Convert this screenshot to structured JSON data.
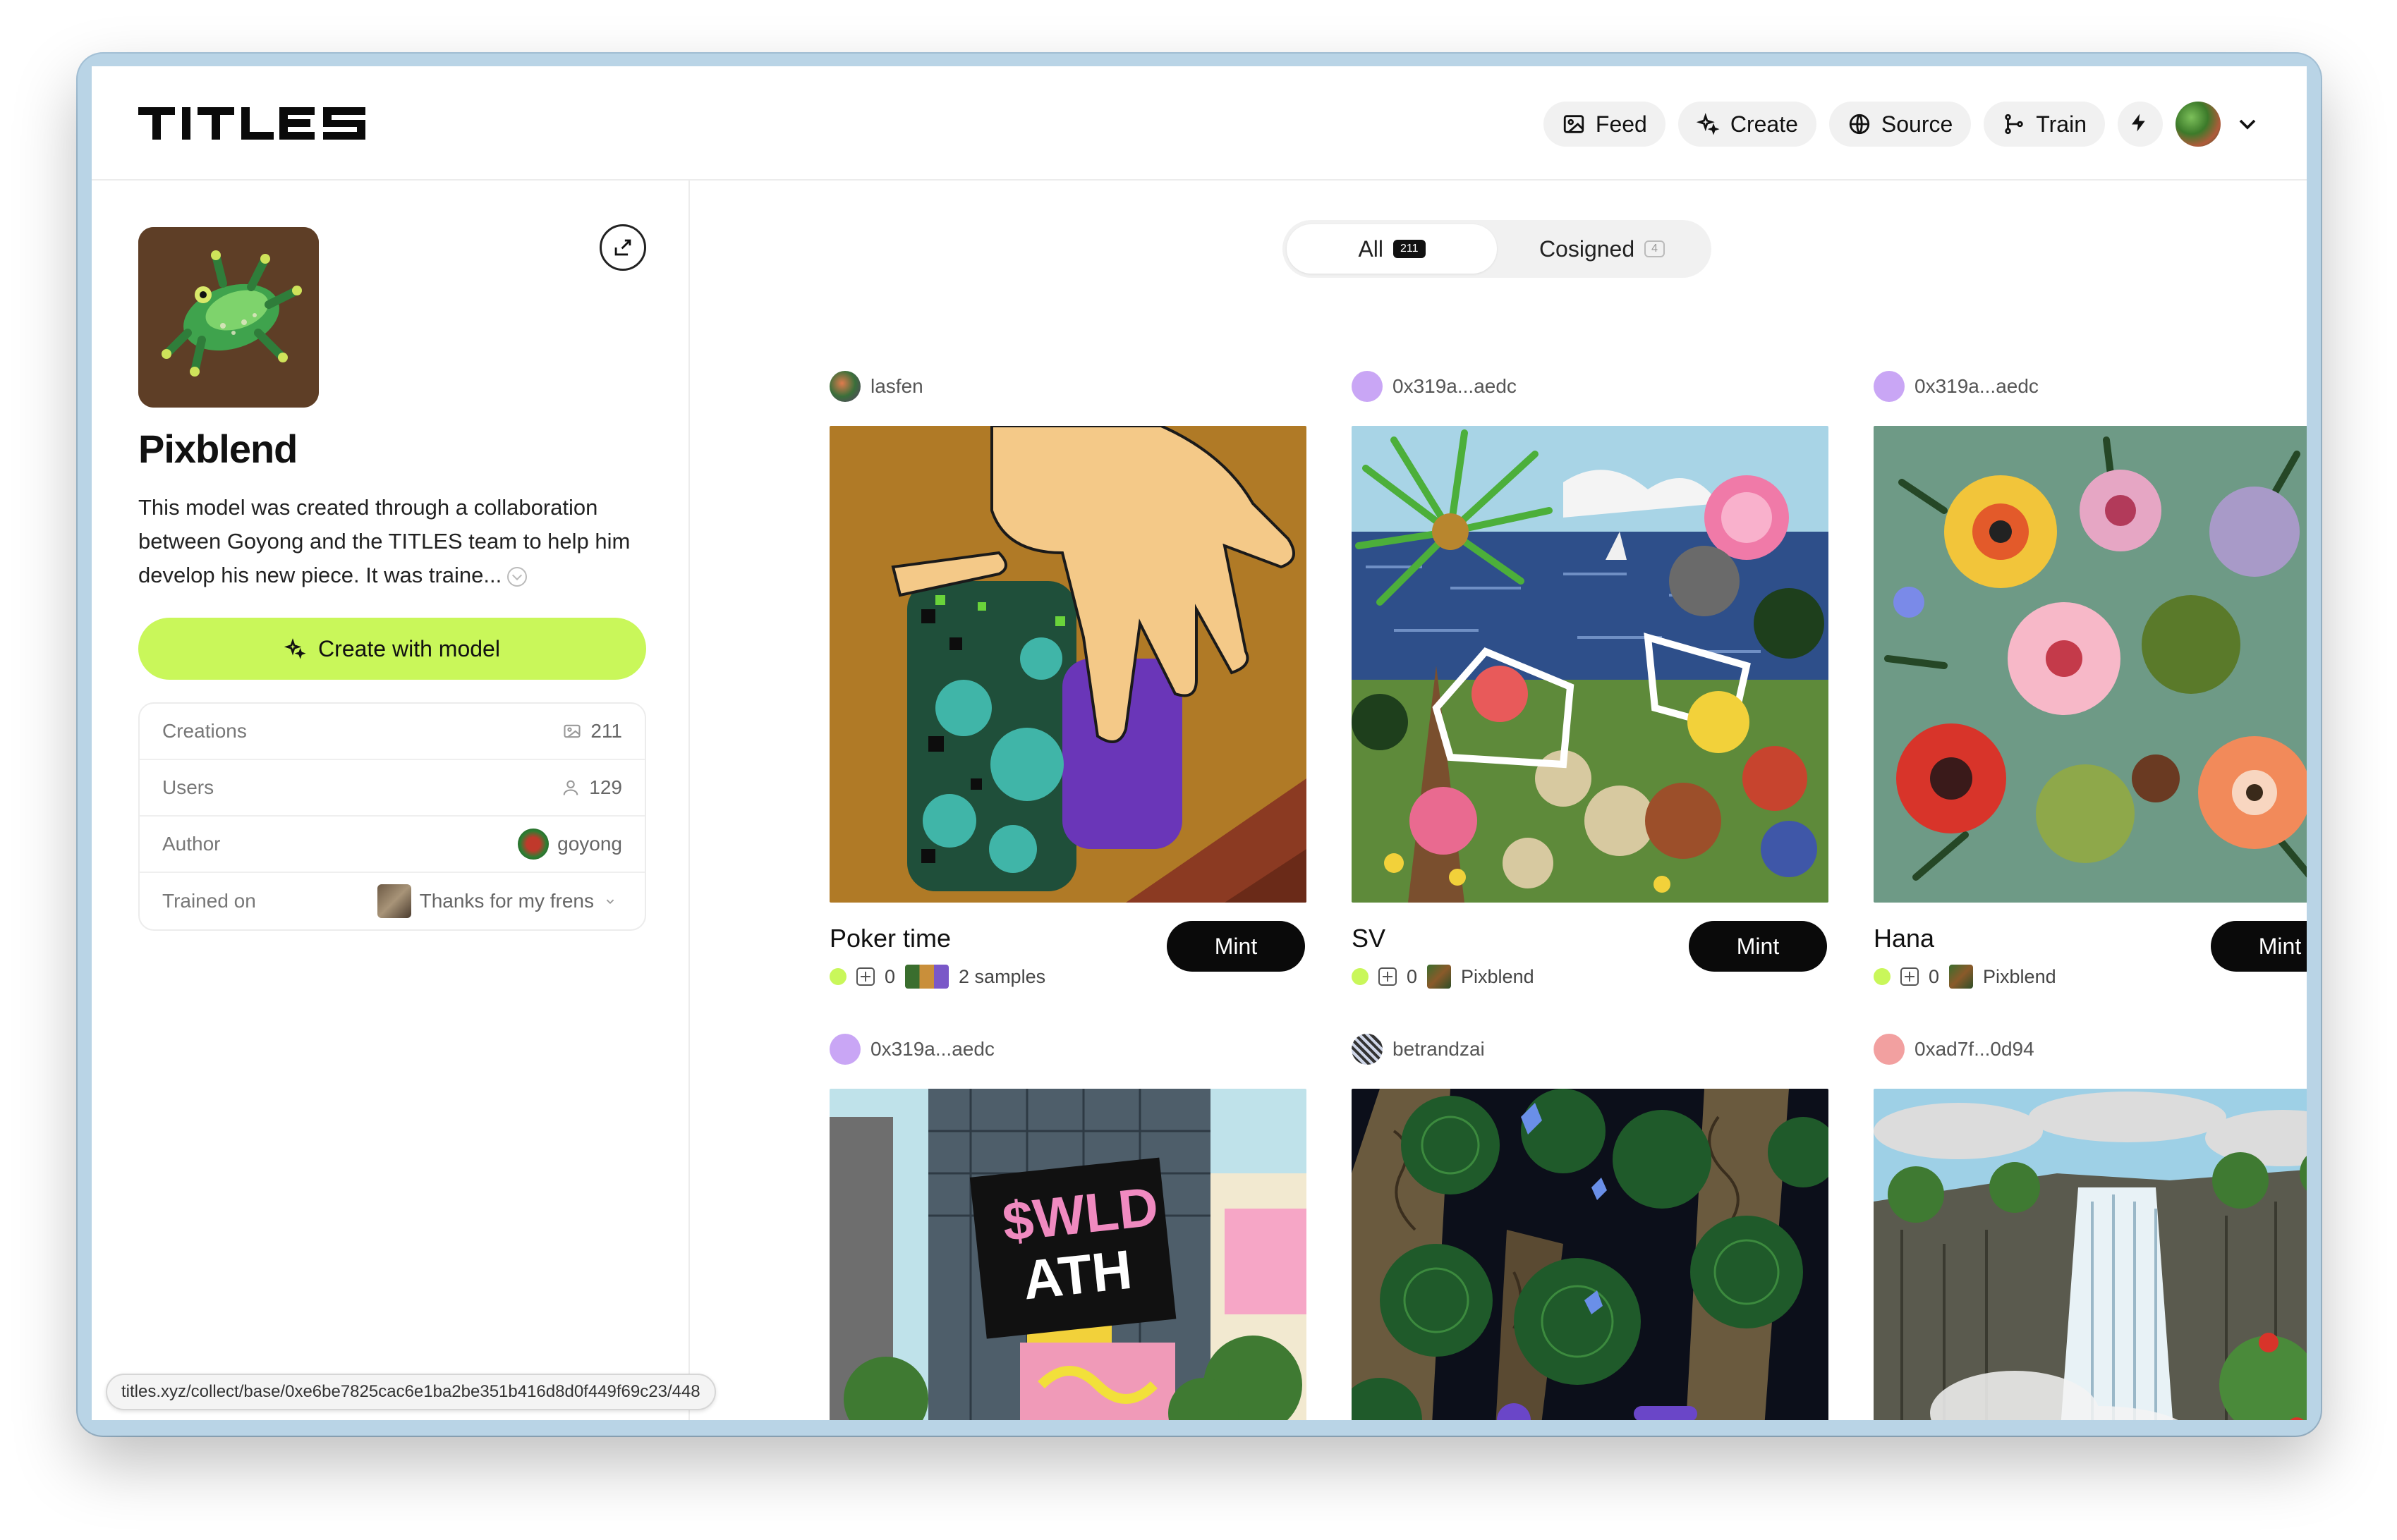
{
  "brand": {
    "logo": "TITLES"
  },
  "nav": {
    "feed": "Feed",
    "create": "Create",
    "source": "Source",
    "train": "Train"
  },
  "model": {
    "name": "Pixblend",
    "description": "This model was created through a collaboration between Goyong and the TITLES team to help him develop his new piece. It was traine...",
    "create_button": "Create with model"
  },
  "stats": [
    {
      "label": "Creations",
      "value": "211",
      "icon": "image-icon"
    },
    {
      "label": "Users",
      "value": "129",
      "icon": "user-icon"
    },
    {
      "label": "Author",
      "value": "goyong",
      "icon": "avatar"
    },
    {
      "label": "Trained on",
      "value": "Thanks for my frens",
      "icon": "thumbnail"
    }
  ],
  "filters": {
    "all_label": "All",
    "all_count": "211",
    "cosigned_label": "Cosigned",
    "cosigned_count": "4"
  },
  "cards": [
    {
      "user": "lasfen",
      "title": "Poker time",
      "count": "0",
      "source": "2 samples",
      "mint": "Mint"
    },
    {
      "user": "0x319a...aedc",
      "title": "SV",
      "count": "0",
      "source": "Pixblend",
      "mint": "Mint"
    },
    {
      "user": "0x319a...aedc",
      "title": "Hana",
      "count": "0",
      "source": "Pixblend",
      "mint": "Mint"
    },
    {
      "user": "0x319a...aedc"
    },
    {
      "user": "betrandzai"
    },
    {
      "user": "0xad7f...0d94"
    }
  ],
  "status_url": "titles.xyz/collect/base/0xe6be7825cac6e1ba2be351b416d8d0f449f69c23/448",
  "colors": {
    "accent": "#c9f75a",
    "mint_button": "#0a0a0a"
  }
}
